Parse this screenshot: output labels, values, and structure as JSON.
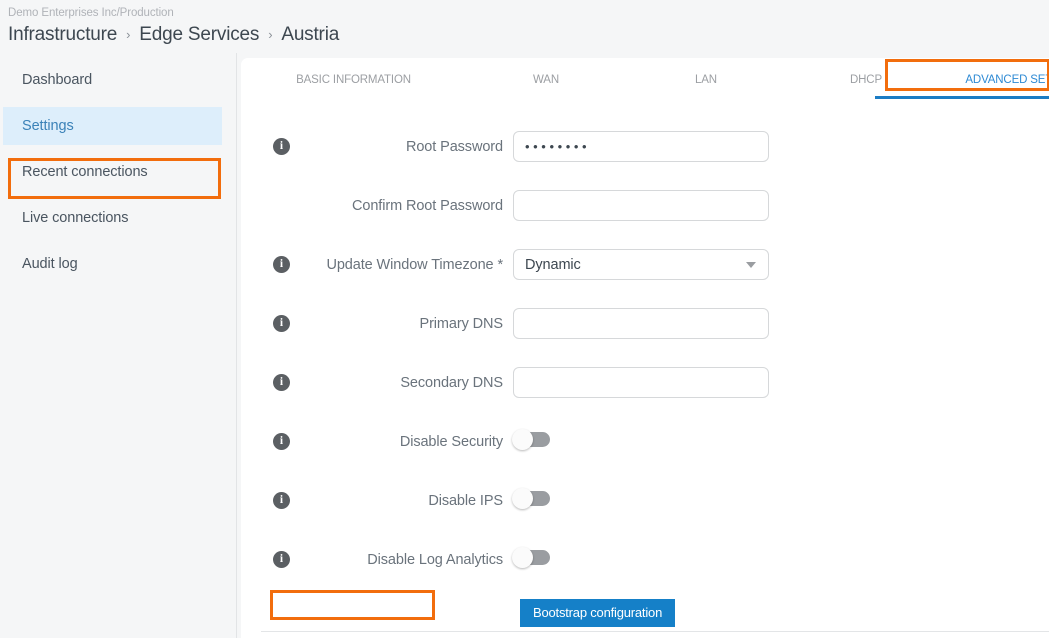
{
  "header": {
    "org_path": "Demo Enterprises Inc/Production",
    "breadcrumb": [
      {
        "label": "Infrastructure"
      },
      {
        "label": "Edge Services"
      },
      {
        "label": "Austria"
      }
    ],
    "separator": "›"
  },
  "sidebar": {
    "items": [
      {
        "label": "Dashboard",
        "active": false
      },
      {
        "label": "Settings",
        "active": true
      },
      {
        "label": "Recent connections",
        "active": false
      },
      {
        "label": "Live connections",
        "active": false
      },
      {
        "label": "Audit log",
        "active": false
      }
    ]
  },
  "tabs": [
    {
      "label": "BASIC INFORMATION",
      "active": false
    },
    {
      "label": "WAN",
      "active": false
    },
    {
      "label": "LAN",
      "active": false
    },
    {
      "label": "DHCP",
      "active": false
    },
    {
      "label": "ADVANCED SETTINGS",
      "active": true
    }
  ],
  "form": {
    "fields": [
      {
        "label": "Root Password",
        "type": "password",
        "has_info": true,
        "value": "••••••••",
        "placeholder": ""
      },
      {
        "label": "Confirm Root Password",
        "type": "text",
        "has_info": false,
        "value": "",
        "placeholder": ""
      },
      {
        "label": "Update Window Timezone *",
        "type": "select",
        "has_info": true,
        "value": "Dynamic",
        "placeholder": ""
      },
      {
        "label": "Primary DNS",
        "type": "text",
        "has_info": true,
        "value": "",
        "placeholder": ""
      },
      {
        "label": "Secondary DNS",
        "type": "text",
        "has_info": true,
        "value": "",
        "placeholder": ""
      },
      {
        "label": "Disable Security",
        "type": "toggle",
        "has_info": true,
        "value": "off",
        "placeholder": ""
      },
      {
        "label": "Disable IPS",
        "type": "toggle",
        "has_info": true,
        "value": "off",
        "placeholder": ""
      },
      {
        "label": "Disable Log Analytics",
        "type": "toggle",
        "has_info": true,
        "value": "off",
        "placeholder": ""
      }
    ],
    "info_icon_glyph": "i",
    "bootstrap_button": "Bootstrap configuration"
  },
  "colors": {
    "accent_blue": "#1580c8",
    "tab_active_blue": "#2e8ad4",
    "annotation_orange": "#f26d0d",
    "sidebar_active_bg": "#ddeefb",
    "page_bg": "#f5f6f7",
    "toggle_off": "#9a9da1"
  }
}
